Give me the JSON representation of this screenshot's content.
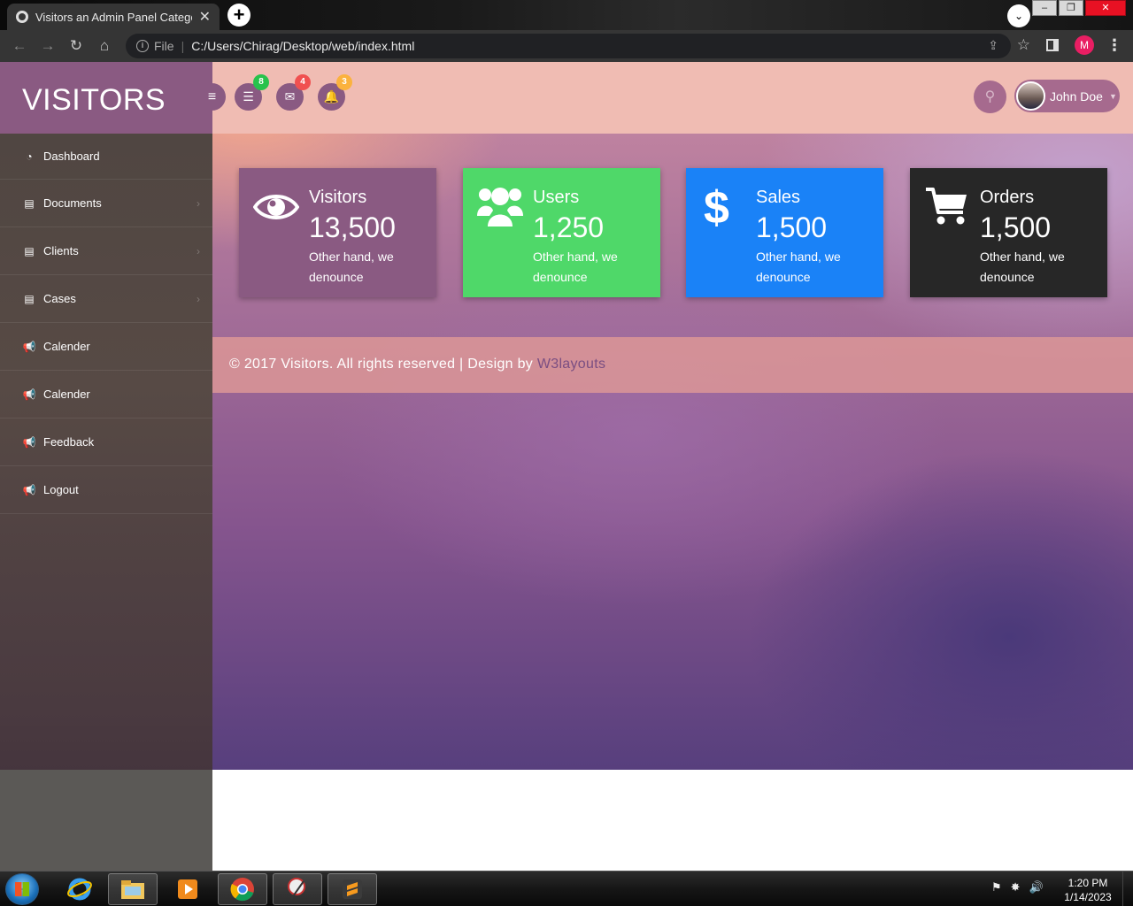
{
  "browser": {
    "tab_title": "Visitors an Admin Panel Category",
    "tab_close": "✕",
    "new_tab": "+",
    "tab_search": "⌄",
    "file_label": "File",
    "url": "C:/Users/Chirag/Desktop/web/index.html",
    "profile_initial": "M",
    "window_min": "–",
    "window_max": "❐",
    "window_close": "✕"
  },
  "brand": "VISITORS",
  "sidebar": {
    "items": [
      {
        "label": "Dashboard",
        "icon": "dashboard-icon",
        "glyph": "◔",
        "chevron": false
      },
      {
        "label": "Documents",
        "icon": "book-icon",
        "glyph": "▤",
        "chevron": true
      },
      {
        "label": "Clients",
        "icon": "book-icon",
        "glyph": "▤",
        "chevron": true
      },
      {
        "label": "Cases",
        "icon": "book-icon",
        "glyph": "▤",
        "chevron": true
      },
      {
        "label": "Calender",
        "icon": "bullhorn-icon",
        "glyph": "📢",
        "chevron": false
      },
      {
        "label": "Calender",
        "icon": "bullhorn-icon",
        "glyph": "📢",
        "chevron": false
      },
      {
        "label": "Feedback",
        "icon": "bullhorn-icon",
        "glyph": "📢",
        "chevron": false
      },
      {
        "label": "Logout",
        "icon": "bullhorn-icon",
        "glyph": "📢",
        "chevron": false
      }
    ],
    "chevron_glyph": "›"
  },
  "header": {
    "menu_glyph": "≡",
    "notifications": [
      {
        "name": "tasks",
        "icon": "list-icon",
        "glyph": "☰",
        "badge": "8",
        "badge_color": "#27c24c"
      },
      {
        "name": "messages",
        "icon": "envelope-icon",
        "glyph": "✉",
        "badge": "4",
        "badge_color": "#f05050"
      },
      {
        "name": "alerts",
        "icon": "bell-icon",
        "glyph": "🔔",
        "badge": "3",
        "badge_color": "#fbb23e"
      }
    ],
    "search_glyph": "⚲",
    "user_name": "John Doe",
    "caret": "▼"
  },
  "cards": [
    {
      "title": "Visitors",
      "value": "13,500",
      "desc": "Other hand, we denounce",
      "color": "#8a5a82",
      "icon": "eye-icon"
    },
    {
      "title": "Users",
      "value": "1,250",
      "desc": "Other hand, we denounce",
      "color": "#4fd869",
      "icon": "users-icon"
    },
    {
      "title": "Sales",
      "value": "1,500",
      "desc": "Other hand, we denounce",
      "color": "#1a82f7",
      "icon": "dollar-icon"
    },
    {
      "title": "Orders",
      "value": "1,500",
      "desc": "Other hand, we denounce",
      "color": "#272727",
      "icon": "cart-icon"
    }
  ],
  "footer": {
    "text": "© 2017 Visitors. All rights reserved | Design by ",
    "link": "W3layouts"
  },
  "taskbar": {
    "time": "1:20 PM",
    "date": "1/14/2023"
  }
}
